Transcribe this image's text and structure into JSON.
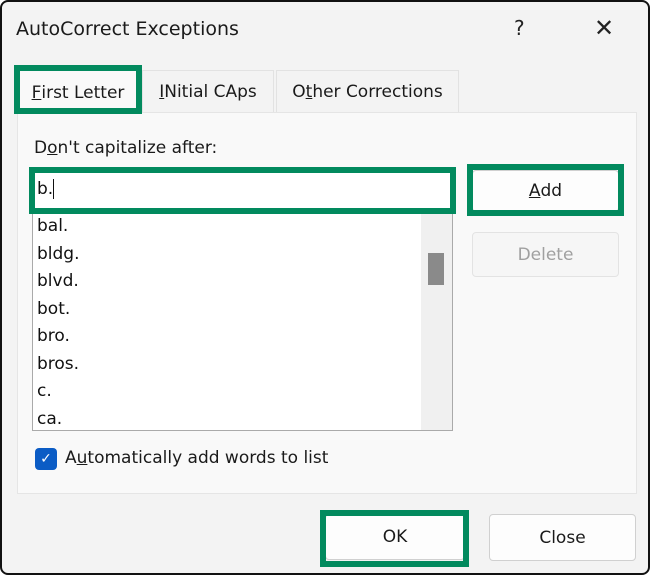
{
  "window": {
    "title": "AutoCorrect Exceptions",
    "help": "?",
    "close": "✕"
  },
  "tabs": [
    {
      "label": "First Letter",
      "accel": "F",
      "rest": "irst Letter",
      "active": true
    },
    {
      "label": "INitial CAps",
      "accel": "I",
      "rest": "Nitial CAps"
    },
    {
      "label": "Other Corrections",
      "pre": "O",
      "accel": "t",
      "rest": "her Corrections"
    }
  ],
  "first_letter": {
    "label_pre": "D",
    "label_accel": "o",
    "label_rest": "n't capitalize after:",
    "input_value": "b.",
    "items": [
      "bal.",
      "bldg.",
      "blvd.",
      "bot.",
      "bro.",
      "bros.",
      "c.",
      "ca."
    ],
    "add": {
      "accel": "A",
      "rest": "dd"
    },
    "delete": "Delete",
    "auto_add": {
      "checked": true,
      "pre": "A",
      "accel": "u",
      "rest": "tomatically add words to list"
    }
  },
  "footer": {
    "ok": "OK",
    "close": "Close"
  },
  "colors": {
    "highlight": "#028a5e",
    "checkbox": "#0b5cc5"
  }
}
